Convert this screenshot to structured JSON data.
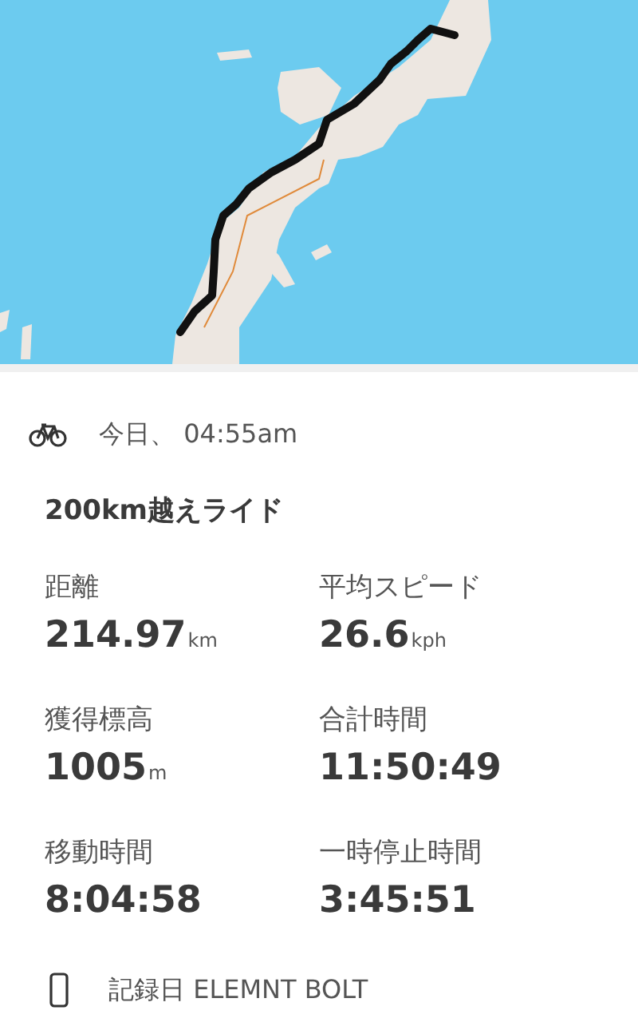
{
  "activity": {
    "time": "今日、 04:55am",
    "title": "200km越えライド"
  },
  "stats": [
    {
      "label": "距離",
      "value": "214.97",
      "unit": "km"
    },
    {
      "label": "平均スピード",
      "value": "26.6",
      "unit": "kph"
    },
    {
      "label": "獲得標高",
      "value": "1005",
      "unit": "m"
    },
    {
      "label": "合計時間",
      "value": "11:50:49"
    },
    {
      "label": "移動時間",
      "value": "8:04:58"
    },
    {
      "label": "一時停止時間",
      "value": "3:45:51"
    }
  ],
  "device": {
    "text": "記録日 ELEMNT BOLT"
  }
}
